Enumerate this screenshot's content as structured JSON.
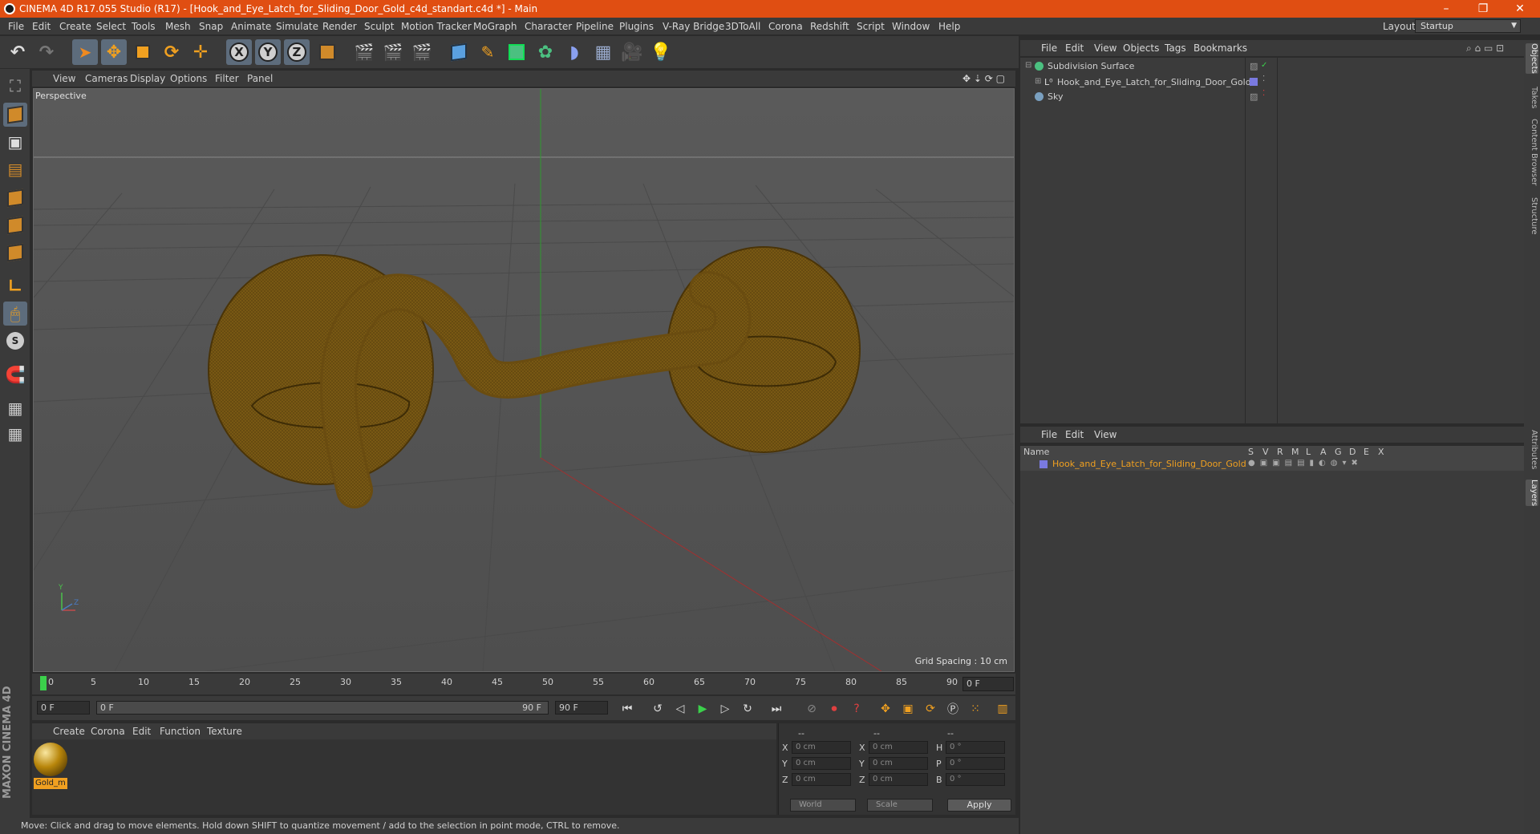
{
  "window": {
    "title": "CINEMA 4D R17.055 Studio (R17) - [Hook_and_Eye_Latch_for_Sliding_Door_Gold_c4d_standart.c4d *] - Main",
    "minimize": "–",
    "maximize": "❐",
    "close": "✕"
  },
  "menubar": {
    "items": [
      "File",
      "Edit",
      "Create",
      "Select",
      "Tools",
      "Mesh",
      "Snap",
      "Animate",
      "Simulate",
      "Render",
      "Sculpt",
      "Motion Tracker",
      "MoGraph",
      "Character",
      "Pipeline",
      "Plugins",
      "V-Ray Bridge",
      "3DToAll",
      "Corona",
      "Redshift",
      "Script",
      "Window",
      "Help"
    ],
    "layout_label": "Layout:",
    "layout_value": "Startup"
  },
  "toolbar": {
    "axis_x": "X",
    "axis_y": "Y",
    "axis_z": "Z"
  },
  "viewport": {
    "menu": [
      "View",
      "Cameras",
      "Display",
      "Options",
      "Filter",
      "Panel"
    ],
    "label": "Perspective",
    "grid_spacing": "Grid Spacing : 10 cm",
    "axis_y": "Y",
    "axis_z": "Z"
  },
  "timeline": {
    "ticks": [
      "0",
      "5",
      "10",
      "15",
      "20",
      "25",
      "30",
      "35",
      "40",
      "45",
      "50",
      "55",
      "60",
      "65",
      "70",
      "75",
      "80",
      "85",
      "90"
    ],
    "current_frame": "0 F"
  },
  "transport": {
    "start": "0 F",
    "range_start": "0 F",
    "range_end": "90 F",
    "end": "90 F"
  },
  "material_manager": {
    "menu": [
      "Create",
      "Corona",
      "Edit",
      "Function",
      "Texture"
    ],
    "materials": [
      {
        "name": "Gold_m"
      }
    ]
  },
  "coordinates": {
    "header": [
      "--",
      "--",
      "--"
    ],
    "rows": [
      {
        "l1": "X",
        "v1": "0 cm",
        "l2": "X",
        "v2": "0 cm",
        "l3": "H",
        "v3": "0 °"
      },
      {
        "l1": "Y",
        "v1": "0 cm",
        "l2": "Y",
        "v2": "0 cm",
        "l3": "P",
        "v3": "0 °"
      },
      {
        "l1": "Z",
        "v1": "0 cm",
        "l2": "Z",
        "v2": "0 cm",
        "l3": "B",
        "v3": "0 °"
      }
    ],
    "space": "World",
    "mode": "Scale",
    "apply": "Apply"
  },
  "status": "Move: Click and drag to move elements. Hold down SHIFT to quantize movement / add to the selection in point mode, CTRL to remove.",
  "objects": {
    "menu": [
      "File",
      "Edit",
      "View",
      "Objects",
      "Tags",
      "Bookmarks"
    ],
    "items": [
      {
        "name": "Subdivision Surface"
      },
      {
        "name": "Hook_and_Eye_Latch_for_Sliding_Door_Gold"
      },
      {
        "name": "Sky"
      }
    ]
  },
  "layers": {
    "menu": [
      "File",
      "Edit",
      "View"
    ],
    "columns": [
      "Name",
      "S",
      "V",
      "R",
      "M",
      "L",
      "A",
      "G",
      "D",
      "E",
      "X"
    ],
    "rows": [
      {
        "name": "Hook_and_Eye_Latch_for_Sliding_Door_Gold"
      }
    ]
  },
  "side_tabs": [
    "Objects",
    "Takes",
    "Content Browser",
    "Structure",
    "Attributes",
    "Layers"
  ],
  "branding": "MAXON CINEMA 4D",
  "colors": {
    "title_bar": "#e04e12",
    "gold_model": "#7a5a14",
    "layer_name": "#f0a020"
  }
}
